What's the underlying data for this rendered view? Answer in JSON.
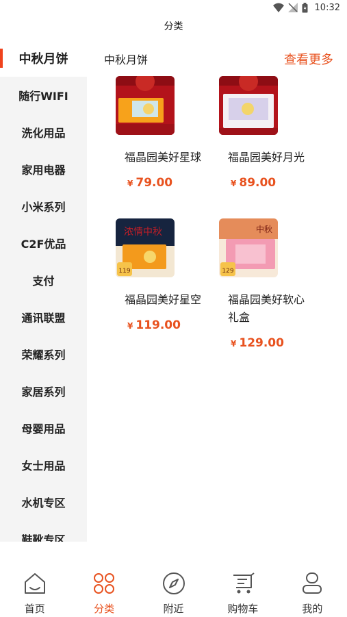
{
  "status": {
    "time": "10:32"
  },
  "header": {
    "title": "分类"
  },
  "sidebar": {
    "items": [
      {
        "label": "中秋月饼"
      },
      {
        "label": "随行WIFI"
      },
      {
        "label": "洗化用品"
      },
      {
        "label": "家用电器"
      },
      {
        "label": "小米系列"
      },
      {
        "label": "C2F优品"
      },
      {
        "label": "支付"
      },
      {
        "label": "通讯联盟"
      },
      {
        "label": "荣耀系列"
      },
      {
        "label": "家居系列"
      },
      {
        "label": "母婴用品"
      },
      {
        "label": "女士用品"
      },
      {
        "label": "水机专区"
      },
      {
        "label": "鞋靴专区"
      }
    ]
  },
  "category": {
    "title": "中秋月饼",
    "more_label": "查看更多"
  },
  "products": [
    {
      "name": "福晶园美好星球",
      "price": "79.00",
      "currency": "¥"
    },
    {
      "name": "福晶园美好月光",
      "price": "89.00",
      "currency": "¥"
    },
    {
      "name": "福晶园美好星空",
      "price": "119.00",
      "currency": "¥",
      "thumb_text": "浓情中秋",
      "badge": "119"
    },
    {
      "name": "福晶园美好软心礼盒",
      "price": "129.00",
      "currency": "¥",
      "thumb_text": "中秋",
      "badge": "129"
    }
  ],
  "tabs": [
    {
      "label": "首页",
      "icon": "home-icon"
    },
    {
      "label": "分类",
      "icon": "category-icon"
    },
    {
      "label": "附近",
      "icon": "compass-icon"
    },
    {
      "label": "购物车",
      "icon": "cart-icon"
    },
    {
      "label": "我的",
      "icon": "profile-icon"
    }
  ],
  "colors": {
    "accent": "#e8521f",
    "sidebar_bg": "#f4f4f4",
    "indicator": "#f0431d"
  }
}
